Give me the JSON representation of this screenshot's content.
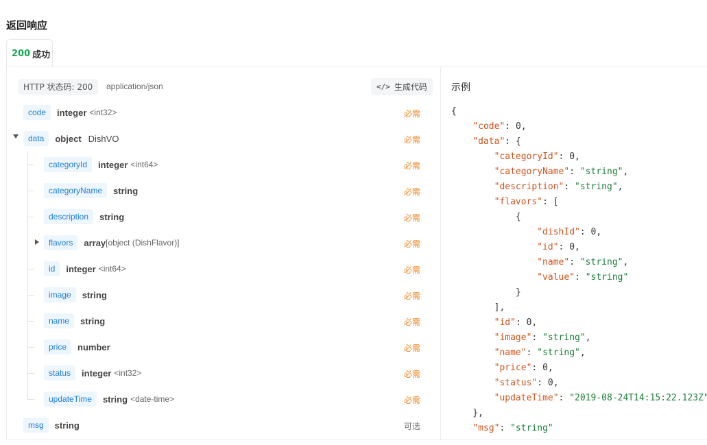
{
  "section_title": "返回响应",
  "tab": {
    "code": "200",
    "label": "成功"
  },
  "status_pill": "HTTP 状态码: 200",
  "content_type": "application/json",
  "generate_code_label": "生成代码",
  "fields": {
    "code": {
      "name": "code",
      "type": "integer",
      "sub": "<int32>",
      "req": "必需"
    },
    "data": {
      "name": "data",
      "type": "object",
      "ref": "DishVO",
      "req": "必需"
    },
    "categoryId": {
      "name": "categoryId",
      "type": "integer",
      "sub": "<int64>",
      "req": "必需"
    },
    "categoryName": {
      "name": "categoryName",
      "type": "string",
      "req": "必需"
    },
    "description": {
      "name": "description",
      "type": "string",
      "req": "必需"
    },
    "flavors": {
      "name": "flavors",
      "type": "array",
      "sub": "[object (DishFlavor)]",
      "req": "必需"
    },
    "id": {
      "name": "id",
      "type": "integer",
      "sub": "<int64>",
      "req": "必需"
    },
    "image": {
      "name": "image",
      "type": "string",
      "req": "必需"
    },
    "name": {
      "name": "name",
      "type": "string",
      "req": "必需"
    },
    "price": {
      "name": "price",
      "type": "number",
      "req": "必需"
    },
    "status": {
      "name": "status",
      "type": "integer",
      "sub": "<int32>",
      "req": "必需"
    },
    "updateTime": {
      "name": "updateTime",
      "type": "string",
      "sub": "<date-time>",
      "req": "必需"
    },
    "msg": {
      "name": "msg",
      "type": "string",
      "req": "可选"
    }
  },
  "example": {
    "title": "示例",
    "lines": [
      {
        "t": [
          [
            "p",
            "{"
          ]
        ]
      },
      {
        "t": [
          [
            "p",
            "    "
          ],
          [
            "k",
            "\"code\""
          ],
          [
            "p",
            ": "
          ],
          [
            "n",
            "0"
          ],
          [
            "p",
            ","
          ]
        ]
      },
      {
        "t": [
          [
            "p",
            "    "
          ],
          [
            "k",
            "\"data\""
          ],
          [
            "p",
            ": {"
          ]
        ]
      },
      {
        "t": [
          [
            "p",
            "        "
          ],
          [
            "k",
            "\"categoryId\""
          ],
          [
            "p",
            ": "
          ],
          [
            "n",
            "0"
          ],
          [
            "p",
            ","
          ]
        ]
      },
      {
        "t": [
          [
            "p",
            "        "
          ],
          [
            "k",
            "\"categoryName\""
          ],
          [
            "p",
            ": "
          ],
          [
            "s",
            "\"string\""
          ],
          [
            "p",
            ","
          ]
        ]
      },
      {
        "t": [
          [
            "p",
            "        "
          ],
          [
            "k",
            "\"description\""
          ],
          [
            "p",
            ": "
          ],
          [
            "s",
            "\"string\""
          ],
          [
            "p",
            ","
          ]
        ]
      },
      {
        "t": [
          [
            "p",
            "        "
          ],
          [
            "k",
            "\"flavors\""
          ],
          [
            "p",
            ": ["
          ]
        ]
      },
      {
        "t": [
          [
            "p",
            "            {"
          ]
        ]
      },
      {
        "t": [
          [
            "p",
            "                "
          ],
          [
            "k",
            "\"dishId\""
          ],
          [
            "p",
            ": "
          ],
          [
            "n",
            "0"
          ],
          [
            "p",
            ","
          ]
        ]
      },
      {
        "t": [
          [
            "p",
            "                "
          ],
          [
            "k",
            "\"id\""
          ],
          [
            "p",
            ": "
          ],
          [
            "n",
            "0"
          ],
          [
            "p",
            ","
          ]
        ]
      },
      {
        "t": [
          [
            "p",
            "                "
          ],
          [
            "k",
            "\"name\""
          ],
          [
            "p",
            ": "
          ],
          [
            "s",
            "\"string\""
          ],
          [
            "p",
            ","
          ]
        ]
      },
      {
        "t": [
          [
            "p",
            "                "
          ],
          [
            "k",
            "\"value\""
          ],
          [
            "p",
            ": "
          ],
          [
            "s",
            "\"string\""
          ]
        ]
      },
      {
        "t": [
          [
            "p",
            "            }"
          ]
        ]
      },
      {
        "t": [
          [
            "p",
            "        ],"
          ]
        ]
      },
      {
        "t": [
          [
            "p",
            "        "
          ],
          [
            "k",
            "\"id\""
          ],
          [
            "p",
            ": "
          ],
          [
            "n",
            "0"
          ],
          [
            "p",
            ","
          ]
        ]
      },
      {
        "t": [
          [
            "p",
            "        "
          ],
          [
            "k",
            "\"image\""
          ],
          [
            "p",
            ": "
          ],
          [
            "s",
            "\"string\""
          ],
          [
            "p",
            ","
          ]
        ]
      },
      {
        "t": [
          [
            "p",
            "        "
          ],
          [
            "k",
            "\"name\""
          ],
          [
            "p",
            ": "
          ],
          [
            "s",
            "\"string\""
          ],
          [
            "p",
            ","
          ]
        ]
      },
      {
        "t": [
          [
            "p",
            "        "
          ],
          [
            "k",
            "\"price\""
          ],
          [
            "p",
            ": "
          ],
          [
            "n",
            "0"
          ],
          [
            "p",
            ","
          ]
        ]
      },
      {
        "t": [
          [
            "p",
            "        "
          ],
          [
            "k",
            "\"status\""
          ],
          [
            "p",
            ": "
          ],
          [
            "n",
            "0"
          ],
          [
            "p",
            ","
          ]
        ]
      },
      {
        "t": [
          [
            "p",
            "        "
          ],
          [
            "k",
            "\"updateTime\""
          ],
          [
            "p",
            ": "
          ],
          [
            "s",
            "\"2019-08-24T14:15:22.123Z\""
          ]
        ]
      },
      {
        "t": [
          [
            "p",
            "    },"
          ]
        ]
      },
      {
        "t": [
          [
            "p",
            "    "
          ],
          [
            "k",
            "\"msg\""
          ],
          [
            "p",
            ": "
          ],
          [
            "s",
            "\"string\""
          ]
        ]
      }
    ]
  }
}
